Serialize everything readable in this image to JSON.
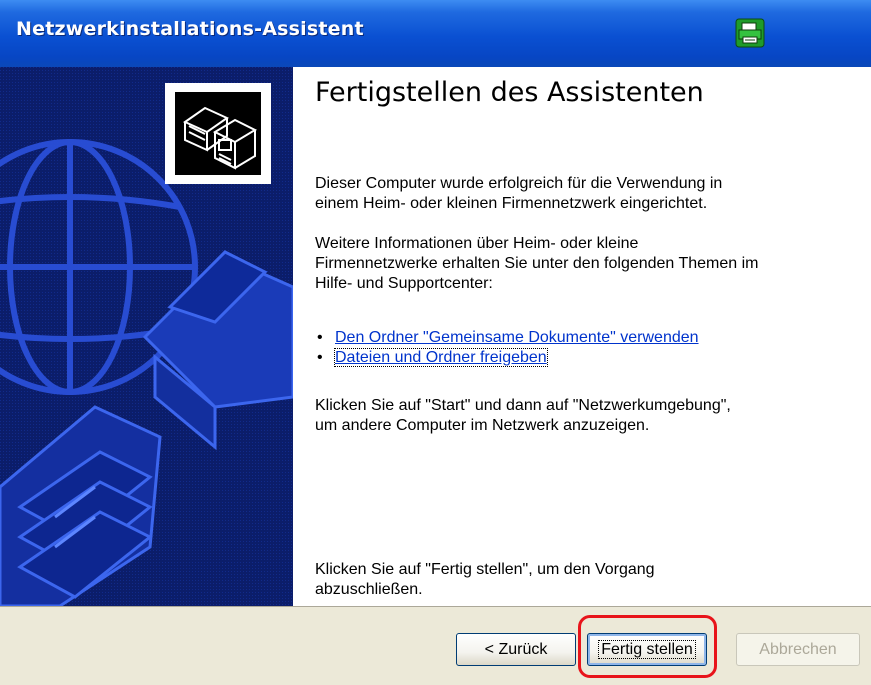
{
  "window": {
    "title": "Netzwerkinstallations-Assistent"
  },
  "content": {
    "heading": "Fertigstellen des Assistenten",
    "paragraph1_line1": "Dieser Computer wurde erfolgreich für die Verwendung in",
    "paragraph1_line2": "einem Heim- oder kleinen Firmennetzwerk eingerichtet.",
    "paragraph2_line1": "Weitere Informationen über Heim- oder kleine",
    "paragraph2_line2": "Firmennetzwerke erhalten Sie unter den folgenden Themen im",
    "paragraph2_line3": "Hilfe- und Supportcenter:",
    "links": [
      {
        "label": "Den Ordner \"Gemeinsame Dokumente\" verwenden"
      },
      {
        "label": "Dateien und Ordner freigeben"
      }
    ],
    "paragraph3_line1": "Klicken Sie auf \"Start\" und dann auf \"Netzwerkumgebung\",",
    "paragraph3_line2": "um andere Computer im Netzwerk anzuzeigen.",
    "paragraph4_line1": "Klicken Sie auf \"Fertig stellen\", um den Vorgang",
    "paragraph4_line2": "abzuschließen."
  },
  "buttons": {
    "back_label": "< Zurück",
    "finish_label": "Fertig stellen",
    "cancel_label": "Abbrechen"
  },
  "colors": {
    "titlebar": "#0a50d2",
    "sidebar": "#0b1d6a",
    "link": "#0033cc",
    "highlight": "#e8141b"
  },
  "icons": {
    "titlebar_icon": "network-printer-icon",
    "logo": "network-computers-icon"
  }
}
